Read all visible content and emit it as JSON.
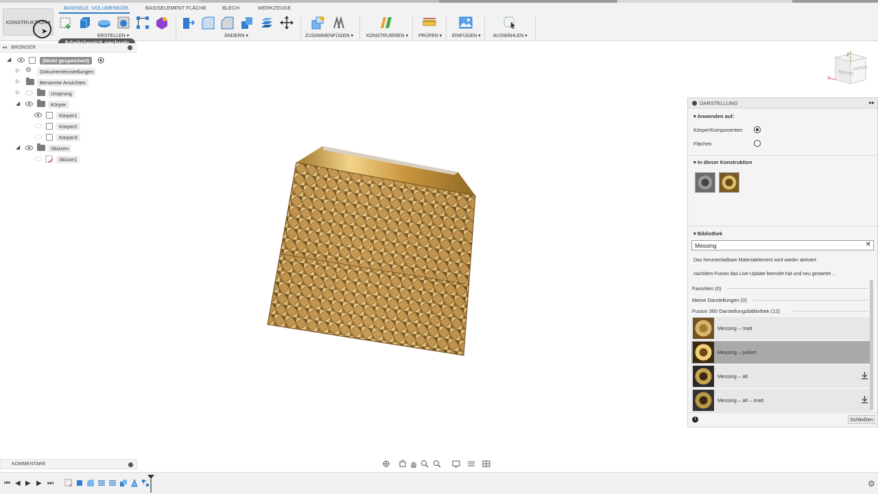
{
  "toolbar": {
    "workspace_label": "KONSTRUKTION",
    "tabs": [
      "BASISELE. VOLUMENKÖR.",
      "BASISELEMENT FLÄCHE",
      "BLECH",
      "WERKZEUGE"
    ],
    "groups": [
      "ERSTELLEN",
      "ÄNDERN",
      "ZUSAMMENFÜGEN",
      "KONSTRUIEREN",
      "PRÜFEN",
      "EINFÜGEN",
      "AUSWÄHLEN"
    ],
    "tooltip": "Arbeitsbereich wechseln"
  },
  "browser": {
    "title": "BROWSER",
    "root": "(Nicht gespeichert)",
    "items": [
      "Dokumenteinstellungen",
      "Benannte Ansichten",
      "Ursprung",
      "Körper",
      "Körper1",
      "Körper2",
      "Körper3",
      "Skizzen",
      "Skizze1"
    ]
  },
  "comments": {
    "title": "KOMMENTARE"
  },
  "viewcube": {
    "faces": [
      "RECHTS",
      "HINTEN"
    ],
    "axes": [
      "Z",
      "X"
    ]
  },
  "panel": {
    "title": "DARSTELLUNG",
    "apply_section": "Anwenden auf:",
    "apply_options": [
      {
        "label": "Körper/Komponenten",
        "selected": true
      },
      {
        "label": "Flächen",
        "selected": false
      }
    ],
    "design_section": "In dieser Konstruktion",
    "library_section": "Bibliothek",
    "search_value": "Messing",
    "info_line1": "Das herunterladbare Materialelement wird wieder aktiviert",
    "info_line2": "nachdem Fusion das Live-Update beendet hat und neu gestartet ...",
    "categories": [
      "Favoriten (0)",
      "Meine Darstellungen (0)",
      "Fusion 360 Darstellungsbibliothek (12)"
    ],
    "materials": [
      {
        "name": "Messing – matt",
        "selected": false,
        "download": false
      },
      {
        "name": "Messing – poliert",
        "selected": true,
        "download": false
      },
      {
        "name": "Messing – alt",
        "selected": false,
        "download": true
      },
      {
        "name": "Messing – alt – matt",
        "selected": false,
        "download": true
      }
    ],
    "close_label": "Schließen"
  },
  "colors": {
    "accent": "#2a7bc4",
    "brass": "#c9a25a"
  }
}
